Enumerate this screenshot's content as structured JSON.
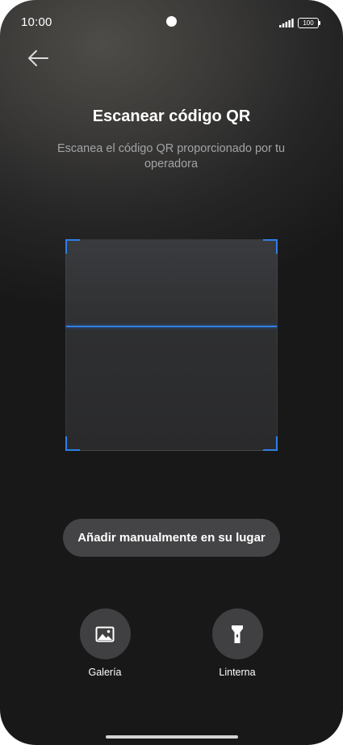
{
  "status_bar": {
    "time": "10:00",
    "battery_level": "100",
    "signal_icon": "cellular-signal-icon",
    "camera_icon": "front-camera-dot"
  },
  "navigation": {
    "back_icon": "arrow-left-icon"
  },
  "header": {
    "title": "Escanear código QR",
    "subtitle": "Escanea el código QR proporcionado por tu operadora"
  },
  "scanner": {
    "accent_color": "#2f7fe6"
  },
  "manual_entry": {
    "label": "Añadir manualmente en su lugar"
  },
  "actions": {
    "gallery": {
      "label": "Galería",
      "icon": "image-icon"
    },
    "flashlight": {
      "label": "Linterna",
      "icon": "flashlight-icon"
    }
  }
}
